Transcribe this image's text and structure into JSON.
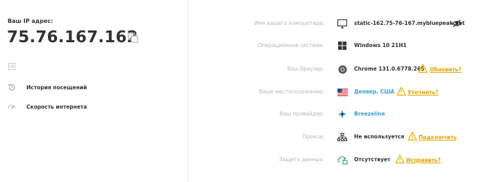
{
  "ip_block": {
    "label": "Ваш IP адрес:",
    "value": "75.76.167.162"
  },
  "nav": [
    {
      "label": "История посещений",
      "icon": "history-icon"
    },
    {
      "label": "Скорость интернета",
      "icon": "speed-gauge-icon"
    }
  ],
  "details": {
    "computer": {
      "label": "Имя вашего компьютера:",
      "value": "static-162.75-76-167.mybluepeak.net",
      "icon": "monitor-icon"
    },
    "os": {
      "label": "Операционная система:",
      "value": "Windows 10 21H1",
      "icon": "windows-icon"
    },
    "browser": {
      "label": "Ваш браузер:",
      "value": "Chrome 131.0.6778.265",
      "icon": "chrome-icon",
      "action": "Обновить?"
    },
    "location": {
      "label": "Ваше местоположение:",
      "value": "Денвер, США",
      "icon": "us-flag-icon",
      "action": "Уточнить?"
    },
    "provider": {
      "label": "Ваш провайдер:",
      "value": "Breezeline",
      "icon": "provider-icon"
    },
    "proxy": {
      "label": "Прокси:",
      "value": "Не используется",
      "icon": "network-icon",
      "action": "Подключить"
    },
    "protection": {
      "label": "Защита данных:",
      "value": "Отсутствует",
      "icon": "unlocked-cloud-icon",
      "action": "Исправить?"
    }
  },
  "colors": {
    "warning": "#e8b100",
    "link": "#3aa0d5",
    "muted_label": "#b5b5b5"
  }
}
